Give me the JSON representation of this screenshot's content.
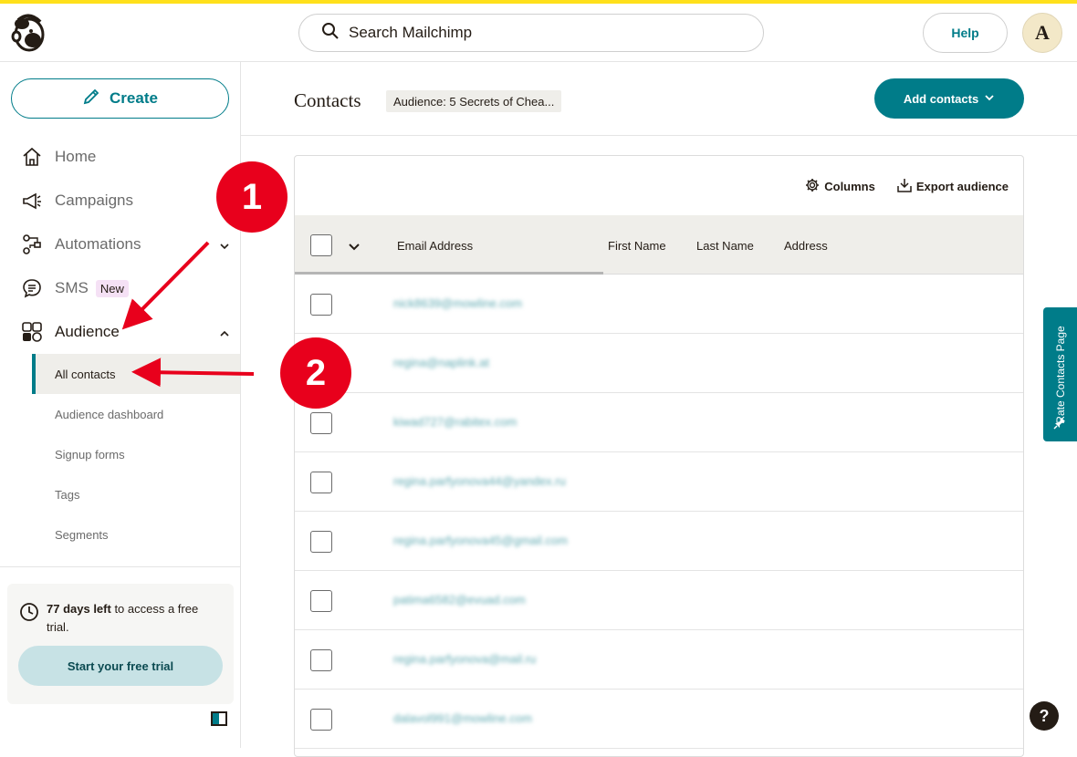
{
  "topbar": {
    "search_placeholder": "Search Mailchimp",
    "help_label": "Help",
    "avatar_initial": "A"
  },
  "sidebar": {
    "create_label": "Create",
    "nav": [
      {
        "label": "Home"
      },
      {
        "label": "Campaigns"
      },
      {
        "label": "Automations"
      },
      {
        "label": "SMS",
        "badge": "New"
      },
      {
        "label": "Audience"
      }
    ],
    "audience_sub": [
      {
        "label": "All contacts"
      },
      {
        "label": "Audience dashboard"
      },
      {
        "label": "Signup forms"
      },
      {
        "label": "Tags"
      },
      {
        "label": "Segments"
      }
    ],
    "trial": {
      "days_bold": "77 days left",
      "rest": " to access a free trial.",
      "button": "Start your free trial"
    }
  },
  "main": {
    "title": "Contacts",
    "audience_badge": "Audience: 5 Secrets of Chea...",
    "add_contacts_label": "Add contacts",
    "columns_label": "Columns",
    "export_label": "Export audience",
    "headers": [
      "Email Address",
      "First Name",
      "Last Name",
      "Address"
    ],
    "emails": [
      "nick8639@mowline.com",
      "regina@naplink.at",
      "kiwad727@rabitex.com",
      "regina.parfyonova44@yandex.ru",
      "regina.parfyonova45@gmail.com",
      "patima6582@evuad.com",
      "regina.parfyonova@mail.ru",
      "dalavol991@mowline.com"
    ]
  },
  "rate_tab": "Rate Contacts Page",
  "help_fab": "?",
  "annotations": {
    "marker_1": "1",
    "marker_2": "2"
  },
  "colors": {
    "brand_yellow": "#ffe01b",
    "accent_teal": "#007c89",
    "annotation_red": "#e8001c"
  }
}
